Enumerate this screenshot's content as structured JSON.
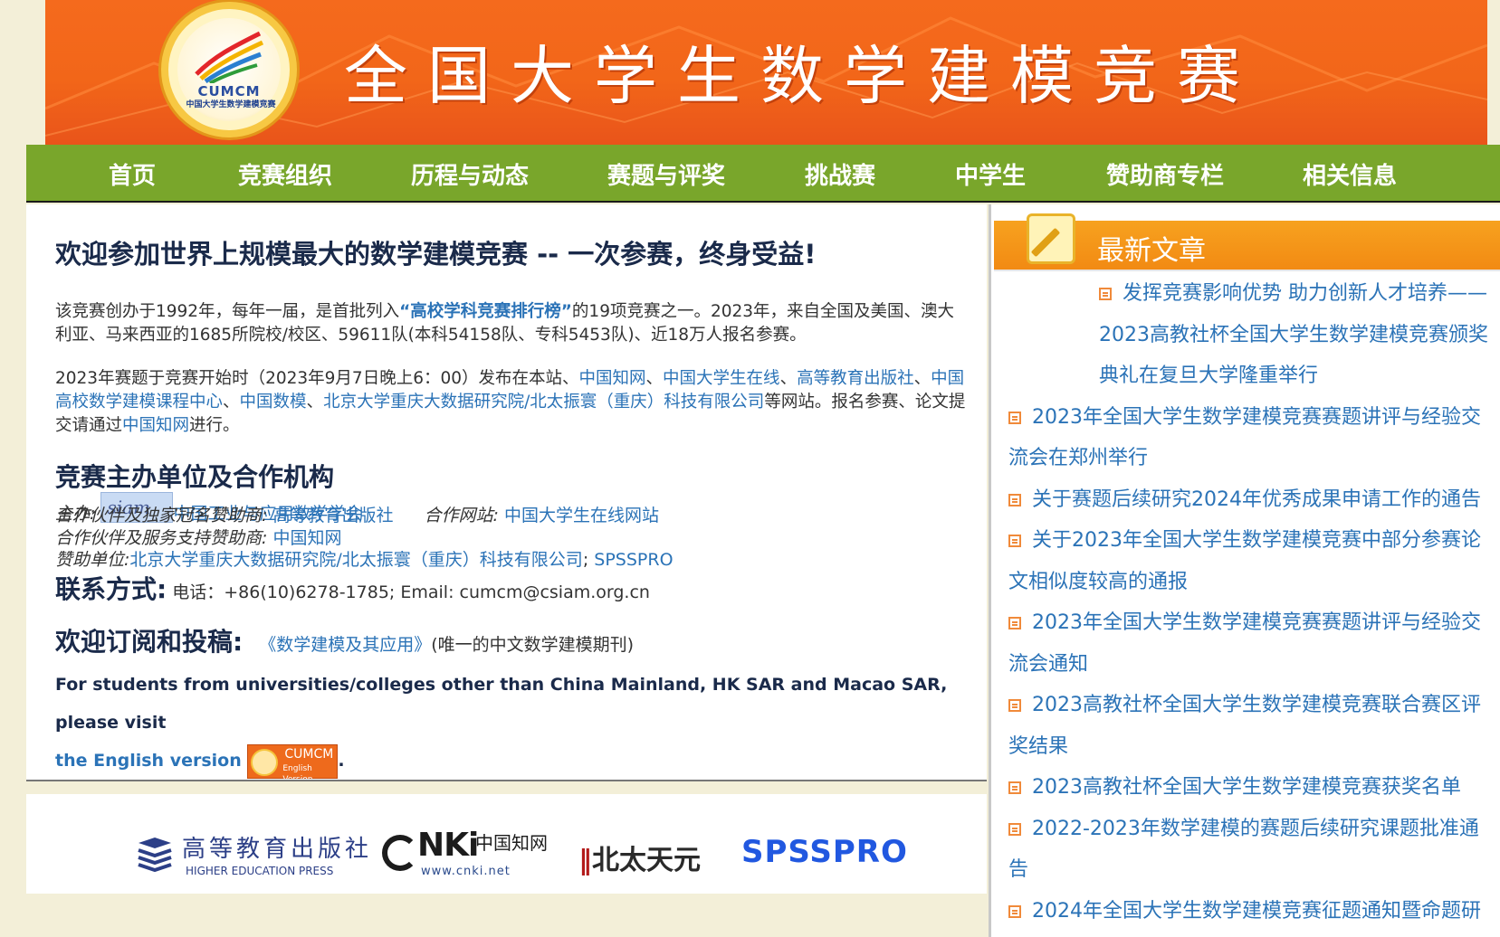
{
  "banner": {
    "title": "全国大学生数学建模竞赛",
    "logo_abbr": "CUMCM",
    "logo_ring_text": "中国大学生数学建模竞赛"
  },
  "nav": {
    "items": [
      "首页",
      "竞赛组织",
      "历程与动态",
      "赛题与评奖",
      "挑战赛",
      "中学生",
      "赞助商专栏",
      "相关信息"
    ]
  },
  "main": {
    "heading": "欢迎参加世界上规模最大的数学建模竞赛 -- 一次参赛，终身受益!",
    "intro": {
      "p1_a": "该竞赛创办于1992年，每年一届，是首批列入",
      "p1_link": "“高校学科竞赛排行榜”",
      "p1_b": "的19项竞赛之一。2023年，来自全国及美国、澳大利亚、马来西亚的1685所院校/校区、59611队(本科54158队、专科5453队)、近18万人报名参赛。",
      "p2_a": "2023年赛题于竞赛开始时（2023年9月7日晚上6：00）发布在本站、",
      "p2_links": [
        "中国知网",
        "中国大学生在线",
        "高等教育出版社",
        "中国高校数学建模课程中心",
        "中国数模",
        "北京大学重庆大数据研究院/北太振寰（重庆）科技有限公司"
      ],
      "p2_seps": [
        "、",
        "、",
        "、",
        "、",
        "、"
      ],
      "p2_b": "等网站。报名参赛、论文提交请通过",
      "p2_c_link": "中国知网",
      "p2_d": "进行。"
    },
    "org_heading": "竞赛主办单位及合作机构",
    "host_label": "主办:",
    "host_logo_text": "siam",
    "host_name": "中国工业与应用数学学会",
    "partner1_label": "合作伙伴及独家冠名赞助商:",
    "partner1_name": "高等教育出版社",
    "partner_site_label": "合作网站:",
    "partner_site_name": "中国大学生在线网站",
    "partner2_label": "合作伙伴及服务支持赞助商:",
    "partner2_name": "中国知网",
    "sponsor_label": "赞助单位:",
    "sponsor_name1": "北京大学重庆大数据研究院/北太振寰（重庆）科技有限公司",
    "sponsor_sep": ";",
    "sponsor_name2": "SPSSPRO",
    "contact_label": "联系方式:",
    "contact_text": "电话：+86(10)6278-1785; Email: cumcm@csiam.org.cn",
    "subscribe_label": "欢迎订阅和投稿:",
    "journal_link": "《数学建模及其应用》",
    "journal_note": "(唯一的中文数学建模期刊)",
    "english_text": "For students from universities/colleges other than China Mainland, HK SAR and Macao SAR, please visit",
    "english_link": "the English version",
    "english_btn_t1": "CUMCM",
    "english_btn_t2": "English Version",
    "english_end": "."
  },
  "sponsors": {
    "hep_cn": "高等教育出版社",
    "hep_en": "HIGHER EDUCATION PRESS",
    "cnki_logo": "NKi",
    "cnki_cn": "中国知网",
    "cnki_url": "www.cnki.net",
    "pku_mark": "北",
    "pku_text": "北太天元",
    "spss": "SPSSPRO"
  },
  "sidebar": {
    "title": "最新文章",
    "news": [
      "发挥竞赛影响优势 助力创新人才培养——2023高教社杯全国大学生数学建模竞赛颁奖典礼在复旦大学隆重举行",
      "2023年全国大学生数学建模竞赛赛题讲评与经验交流会在郑州举行",
      "关于赛题后续研究2024年优秀成果申请工作的通告",
      "关于2023年全国大学生数学建模竞赛中部分参赛论文相似度较高的通报",
      "2023年全国大学生数学建模竞赛赛题讲评与经验交流会通知",
      "2023高教社杯全国大学生数学建模竞赛联合赛区评奖结果",
      "2023高教社杯全国大学生数学建模竞赛获奖名单",
      "2022-2023年数学建模的赛题后续研究课题批准通告",
      "2024年全国大学生数学建模竞赛征题通知暨命题研"
    ]
  },
  "colors": {
    "banner": "#f26619",
    "nav": "#79a62b",
    "link": "#2b73b7",
    "sidebar_head": "#f5971b",
    "page_bg": "#f3efd8"
  }
}
